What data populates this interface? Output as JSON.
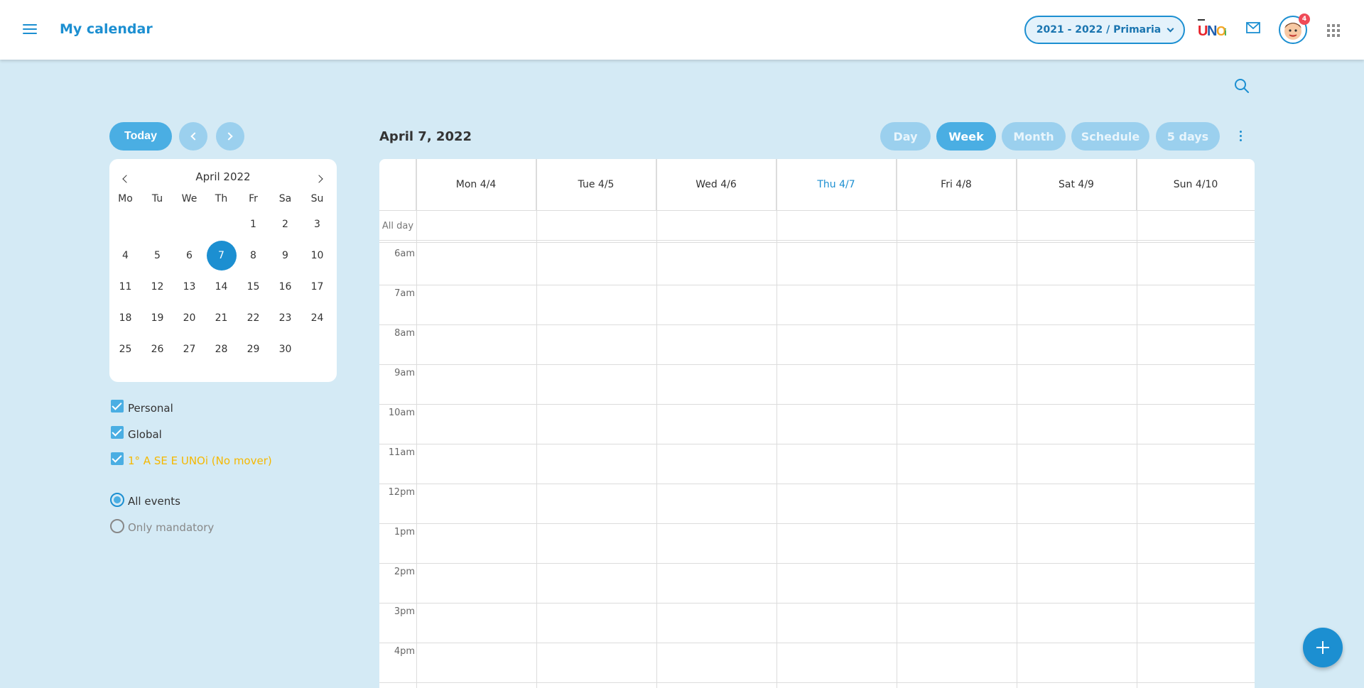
{
  "header": {
    "title": "My calendar",
    "year_selector": "2021 - 2022 / Primaria",
    "notification_count": "4",
    "logo_text": "UNOi"
  },
  "nav": {
    "today_label": "Today"
  },
  "mini_calendar": {
    "month_label": "April 2022",
    "weekdays": [
      "Mo",
      "Tu",
      "We",
      "Th",
      "Fr",
      "Sa",
      "Su"
    ],
    "weeks": [
      [
        "",
        "",
        "",
        "",
        "1",
        "2",
        "3"
      ],
      [
        "4",
        "5",
        "6",
        "7",
        "8",
        "9",
        "10"
      ],
      [
        "11",
        "12",
        "13",
        "14",
        "15",
        "16",
        "17"
      ],
      [
        "18",
        "19",
        "20",
        "21",
        "22",
        "23",
        "24"
      ],
      [
        "25",
        "26",
        "27",
        "28",
        "29",
        "30",
        ""
      ]
    ],
    "selected_day": "7"
  },
  "filters": {
    "calendars": [
      {
        "label": "Personal",
        "checked": true,
        "color": "#333333"
      },
      {
        "label": "Global",
        "checked": true,
        "color": "#333333"
      },
      {
        "label": "1° A SE E UNOi (No mover)",
        "checked": true,
        "color": "#f5b800"
      }
    ],
    "event_filter": [
      {
        "label": "All events",
        "selected": true
      },
      {
        "label": "Only mandatory",
        "selected": false
      }
    ]
  },
  "main": {
    "date_title": "April 7, 2022",
    "views": [
      "Day",
      "Week",
      "Month",
      "Schedule",
      "5 days"
    ],
    "active_view": "Week",
    "all_day_label": "All day",
    "days": [
      "Mon 4/4",
      "Tue 4/5",
      "Wed 4/6",
      "Thu 4/7",
      "Fri 4/8",
      "Sat 4/9",
      "Sun 4/10"
    ],
    "today_column": "Thu 4/7",
    "hours": [
      "6am",
      "7am",
      "8am",
      "9am",
      "10am",
      "11am",
      "12pm",
      "1pm",
      "2pm",
      "3pm",
      "4pm"
    ]
  },
  "colors": {
    "accent": "#1c8fd1",
    "button_active": "#4aaee3",
    "button_inactive": "#9bd0ee",
    "background": "#d4eaf5",
    "badge": "#ef4a57"
  }
}
